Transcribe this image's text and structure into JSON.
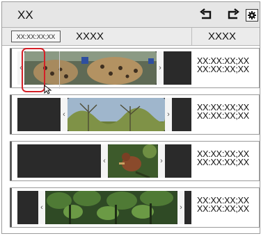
{
  "window": {
    "title": "XX"
  },
  "toolbar": {
    "undo_icon": "undo-arrow-icon",
    "redo_icon": "redo-arrow-icon",
    "settings_icon": "gear-icon"
  },
  "header": {
    "timecode": "XX:XX:XX;XX",
    "clip_column": "XXXX",
    "timecode_column": "XXXX"
  },
  "clips": [
    {
      "in": "XX:XX:XX;XX",
      "out": "XX:XX:XX;XX",
      "scene": "leopard"
    },
    {
      "in": "XX:XX:XX;XX",
      "out": "XX:XX:XX;XX",
      "scene": "trees"
    },
    {
      "in": "XX:XX:XX;XX",
      "out": "XX:XX:XX;XX",
      "scene": "bird"
    },
    {
      "in": "XX:XX:XX;XX",
      "out": "XX:XX:XX;XX",
      "scene": "forest"
    }
  ],
  "colors": {
    "highlight": "#d42027",
    "strip": "#2a2a2a"
  }
}
